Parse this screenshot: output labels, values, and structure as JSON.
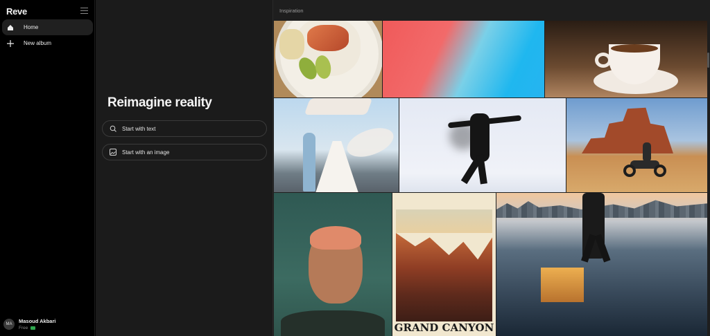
{
  "app": {
    "brand": "Reve"
  },
  "sidebar": {
    "items": [
      {
        "label": "Home",
        "icon": "home-icon",
        "active": true
      },
      {
        "label": "New album",
        "icon": "plus-icon",
        "active": false
      }
    ],
    "user": {
      "initials": "MA",
      "name": "Masoud Akbari",
      "plan": "Free",
      "plan_color": "#2fa84f"
    }
  },
  "main": {
    "headline": "Reimagine reality",
    "actions": [
      {
        "label": "Start with text",
        "icon": "search-icon"
      },
      {
        "label": "Start with an image",
        "icon": "image-icon"
      }
    ]
  },
  "inspiration": {
    "title": "Inspiration",
    "poster_text": "GRAND CANYON"
  },
  "colors": {
    "sidebar_bg": "#000000",
    "main_bg": "#1b1b1b",
    "active_item_bg": "#202020"
  }
}
